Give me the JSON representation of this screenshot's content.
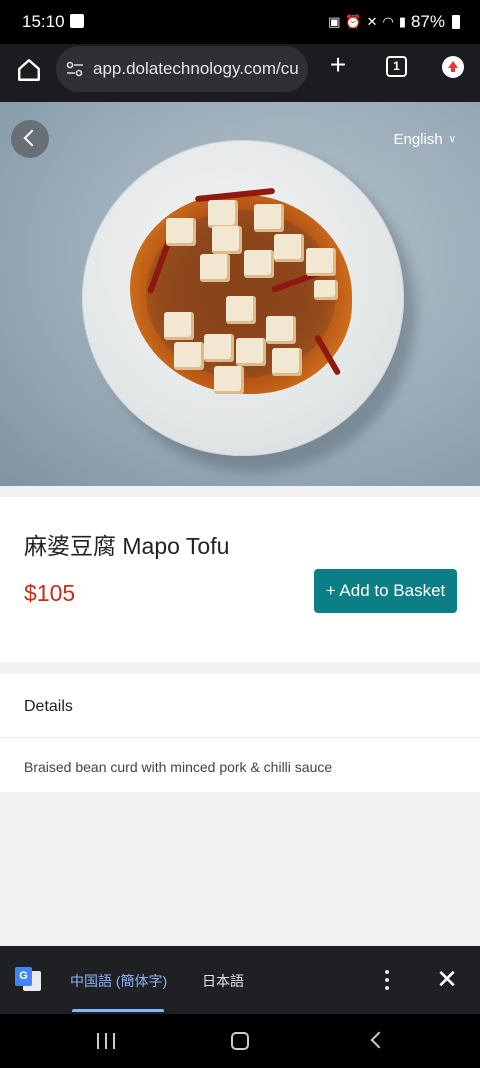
{
  "status_bar": {
    "time": "15:10",
    "battery": "87%",
    "icons": [
      "image-icon",
      "battery-saver-icon",
      "alarm-icon",
      "mute-icon",
      "wifi-icon",
      "signal-icon",
      "battery-icon"
    ]
  },
  "browser": {
    "url": "app.dolatechnology.com/cu",
    "tab_count": "1"
  },
  "hero": {
    "language": "English"
  },
  "product": {
    "name": "麻婆豆腐 Mapo Tofu",
    "price": "$105",
    "add_button": "+ Add to Basket"
  },
  "details": {
    "title": "Details",
    "description": "Braised bean curd with minced pork & chilli sauce"
  },
  "translate_bar": {
    "languages": [
      "中国語 (簡体字)",
      "日本語"
    ],
    "selected": "中国語 (簡体字)"
  },
  "colors": {
    "accent": "#0b7f85",
    "price": "#c62e1a",
    "translate_selected": "#8ab4f8"
  }
}
